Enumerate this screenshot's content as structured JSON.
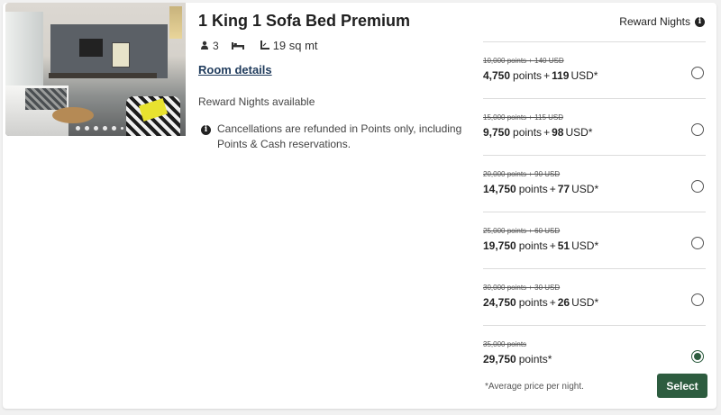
{
  "room": {
    "title": "1 King 1 Sofa Bed Premium",
    "guests": "3",
    "size": "19 sq mt",
    "details_link": "Room details",
    "reward_available": "Reward Nights available",
    "cancellation_note": "Cancellations are refunded in Points only, including Points & Cash reservations."
  },
  "rates_header": {
    "label": "Reward Nights"
  },
  "rates": [
    {
      "original": "10,000 points + 140 USD",
      "points": "4,750",
      "points_label": "points",
      "plus": "+",
      "cash": "119",
      "cash_label": "USD*",
      "selected": false
    },
    {
      "original": "15,000 points + 115 USD",
      "points": "9,750",
      "points_label": "points",
      "plus": "+",
      "cash": "98",
      "cash_label": "USD*",
      "selected": false
    },
    {
      "original": "20,000 points + 90 USD",
      "points": "14,750",
      "points_label": "points",
      "plus": "+",
      "cash": "77",
      "cash_label": "USD*",
      "selected": false
    },
    {
      "original": "25,000 points + 60 USD",
      "points": "19,750",
      "points_label": "points",
      "plus": "+",
      "cash": "51",
      "cash_label": "USD*",
      "selected": false
    },
    {
      "original": "30,000 points + 30 USD",
      "points": "24,750",
      "points_label": "points",
      "plus": "+",
      "cash": "26",
      "cash_label": "USD*",
      "selected": false
    },
    {
      "original": "35,000 points",
      "points": "29,750",
      "points_label": "points*",
      "plus": "",
      "cash": "",
      "cash_label": "",
      "selected": true
    }
  ],
  "footer": {
    "avg_note": "*Average price per night.",
    "select_label": "Select"
  },
  "colors": {
    "accent": "#2d5c3f",
    "link": "#1f3b5c"
  },
  "icons": {
    "guests": "person-icon",
    "bed": "bed-icon",
    "size": "area-icon",
    "info": "info-icon"
  }
}
